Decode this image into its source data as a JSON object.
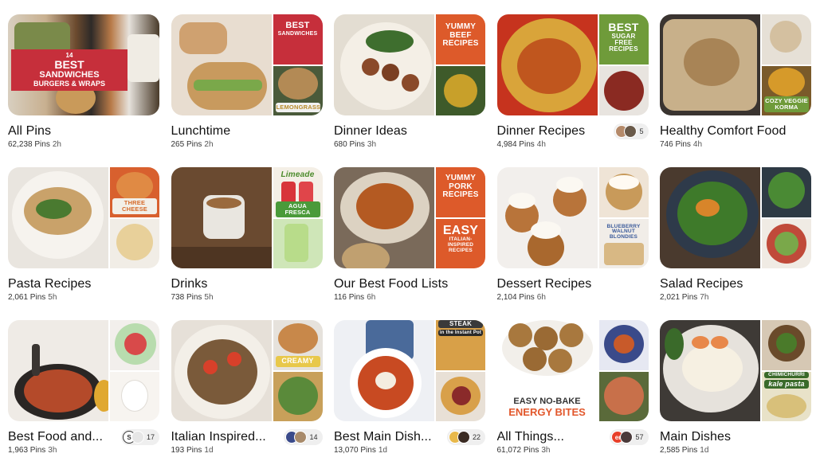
{
  "boards": [
    {
      "title": "All Pins",
      "pins": "62,238 Pins",
      "age": "2h",
      "collaborators": null
    },
    {
      "title": "Lunchtime",
      "pins": "265 Pins",
      "age": "2h",
      "collaborators": null
    },
    {
      "title": "Dinner Ideas",
      "pins": "680 Pins",
      "age": "3h",
      "collaborators": null
    },
    {
      "title": "Dinner Recipes",
      "pins": "4,984 Pins",
      "age": "4h",
      "collaborators": "5"
    },
    {
      "title": "Healthy Comfort Food",
      "pins": "746 Pins",
      "age": "4h",
      "collaborators": null
    },
    {
      "title": "Pasta Recipes",
      "pins": "2,061 Pins",
      "age": "5h",
      "collaborators": null
    },
    {
      "title": "Drinks",
      "pins": "738 Pins",
      "age": "5h",
      "collaborators": null
    },
    {
      "title": "Our Best Food Lists",
      "pins": "116 Pins",
      "age": "6h",
      "collaborators": null
    },
    {
      "title": "Dessert Recipes",
      "pins": "2,104 Pins",
      "age": "6h",
      "collaborators": null
    },
    {
      "title": "Salad Recipes",
      "pins": "2,021 Pins",
      "age": "7h",
      "collaborators": null
    },
    {
      "title": "Best Food and...",
      "pins": "1,963 Pins",
      "age": "3h",
      "collaborators": "17"
    },
    {
      "title": "Italian Inspired...",
      "pins": "193 Pins",
      "age": "1d",
      "collaborators": "14"
    },
    {
      "title": "Best Main Dish...",
      "pins": "13,070 Pins",
      "age": "1d",
      "collaborators": "22"
    },
    {
      "title": "All Things...",
      "pins": "61,072 Pins",
      "age": "3h",
      "collaborators": "57"
    },
    {
      "title": "Main Dishes",
      "pins": "2,585 Pins",
      "age": "1d",
      "collaborators": null
    }
  ],
  "cover_texts": {
    "best_sandwiches": "BEST",
    "best_sandwiches_sub": "SANDWICHES",
    "best_sandwiches_sub2": "BURGERS & WRAPS",
    "lemongrass": "LEMONGRASS",
    "yummy_beef": "YUMMY BEEF RECIPES",
    "best_sugar_free": "BEST",
    "sugar_free_sub": "SUGAR FREE RECIPES",
    "cozy_veggie": "COZY VEGGIE KORMA",
    "three_cheese": "THREE CHEESE",
    "limeade": "Limeade",
    "agua_fresca": "AGUA FRESCA",
    "yummy_pork": "YUMMY PORK RECIPES",
    "easy": "EASY",
    "italian_inspired": "ITALIAN-INSPIRED RECIPES",
    "blueberry_blondies": "BLUEBERRY WALNUT BLONDIES",
    "creamy": "CREAMY",
    "steak": "STEAK",
    "instant_pot": "in the Instant Pot",
    "easy_no_bake": "EASY NO-BAKE",
    "energy_bites": "ENERGY BITES",
    "chimichurri": "CHIMICHURRI",
    "kale_pasta": "kale pasta",
    "badge_14": "14",
    "badge_s": "S",
    "badge_er": "er"
  },
  "colors": {
    "red_badge": "#c62f3b",
    "orange_badge": "#dd5a2a",
    "green_badge": "#6f9b3a",
    "orange_text": "#e2572b",
    "collab_bg": "#efefef"
  }
}
